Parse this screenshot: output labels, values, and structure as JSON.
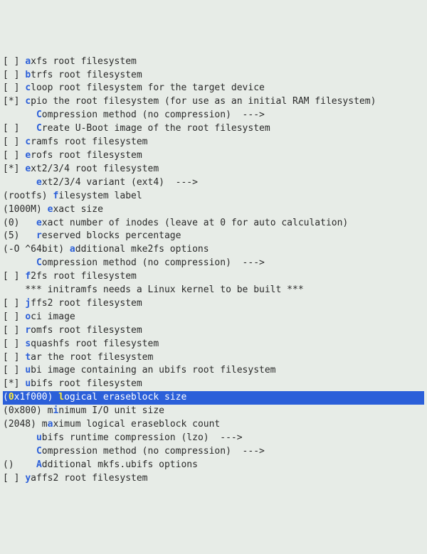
{
  "rows": [
    {
      "prefix": "[ ] ",
      "hot": "a",
      "rest": "xfs root filesystem",
      "interactable": true,
      "name": "opt-axfs"
    },
    {
      "prefix": "[ ] ",
      "hot": "b",
      "rest": "trfs root filesystem",
      "interactable": true,
      "name": "opt-btrfs"
    },
    {
      "prefix": "[ ] ",
      "hot": "c",
      "rest": "loop root filesystem for the target device",
      "interactable": true,
      "name": "opt-cloop"
    },
    {
      "prefix": "[*] ",
      "hot": "c",
      "rest": "pio the root filesystem (for use as an initial RAM filesystem)",
      "interactable": true,
      "name": "opt-cpio"
    },
    {
      "prefix": "      ",
      "hot": "C",
      "rest": "ompression method (no compression)  --->",
      "interactable": true,
      "name": "menu-cpio-compression"
    },
    {
      "prefix": "[ ]   ",
      "hot": "C",
      "rest": "reate U-Boot image of the root filesystem",
      "interactable": true,
      "name": "opt-cpio-uboot"
    },
    {
      "prefix": "[ ] ",
      "hot": "c",
      "rest": "ramfs root filesystem",
      "interactable": true,
      "name": "opt-cramfs"
    },
    {
      "prefix": "[ ] ",
      "hot": "e",
      "rest": "rofs root filesystem",
      "interactable": true,
      "name": "opt-erofs"
    },
    {
      "prefix": "[*] ",
      "hot": "e",
      "rest": "xt2/3/4 root filesystem",
      "interactable": true,
      "name": "opt-ext"
    },
    {
      "prefix": "      ",
      "hot": "e",
      "rest": "xt2/3/4 variant (ext4)  --->",
      "interactable": true,
      "name": "menu-ext-variant"
    },
    {
      "prefix": "(rootfs) ",
      "hot": "f",
      "rest": "ilesystem label",
      "interactable": true,
      "name": "input-fs-label"
    },
    {
      "prefix": "(1000M) ",
      "hot": "e",
      "rest": "xact size",
      "interactable": true,
      "name": "input-exact-size"
    },
    {
      "prefix": "(0)   ",
      "hot": "e",
      "rest": "xact number of inodes (leave at 0 for auto calculation)",
      "interactable": true,
      "name": "input-inodes"
    },
    {
      "prefix": "(5)   ",
      "hot": "r",
      "rest": "eserved blocks percentage",
      "interactable": true,
      "name": "input-reserved-blocks"
    },
    {
      "prefix": "(-O ^64bit) ",
      "hot": "a",
      "rest": "dditional mke2fs options",
      "interactable": true,
      "name": "input-mke2fs-options"
    },
    {
      "prefix": "      ",
      "hot": "C",
      "rest": "ompression method (no compression)  --->",
      "interactable": true,
      "name": "menu-ext-compression"
    },
    {
      "prefix": "[ ] ",
      "hot": "f",
      "rest": "2fs root filesystem",
      "interactable": true,
      "name": "opt-f2fs"
    },
    {
      "prefix": "    *** initramfs needs a Linux kernel to be built ***",
      "hot": "",
      "rest": "",
      "interactable": false,
      "name": "comment-initramfs"
    },
    {
      "prefix": "[ ] ",
      "hot": "j",
      "rest": "ffs2 root filesystem",
      "interactable": true,
      "name": "opt-jffs2"
    },
    {
      "prefix": "[ ] ",
      "hot": "o",
      "rest": "ci image",
      "interactable": true,
      "name": "opt-oci"
    },
    {
      "prefix": "[ ] ",
      "hot": "r",
      "rest": "omfs root filesystem",
      "interactable": true,
      "name": "opt-romfs"
    },
    {
      "prefix": "[ ] ",
      "hot": "s",
      "rest": "quashfs root filesystem",
      "interactable": true,
      "name": "opt-squashfs"
    },
    {
      "prefix": "[ ] ",
      "hot": "t",
      "rest": "ar the root filesystem",
      "interactable": true,
      "name": "opt-tar"
    },
    {
      "prefix": "[ ] ",
      "hot": "u",
      "rest": "bi image containing an ubifs root filesystem",
      "interactable": true,
      "name": "opt-ubi"
    },
    {
      "prefix": "[*] ",
      "hot": "u",
      "rest": "bifs root filesystem",
      "interactable": true,
      "name": "opt-ubifs"
    },
    {
      "prefix": "(",
      "hot": "0",
      "rest": "x1f000) ",
      "hot2": "l",
      "rest2": "ogical eraseblock size",
      "interactable": true,
      "name": "input-leb-size",
      "selected": true
    },
    {
      "prefix": "(0x800) m",
      "hot": "i",
      "rest": "nimum I/O unit size",
      "interactable": true,
      "name": "input-min-io"
    },
    {
      "prefix": "(2048) m",
      "hot": "a",
      "rest": "ximum logical eraseblock count",
      "interactable": true,
      "name": "input-max-leb"
    },
    {
      "prefix": "      ",
      "hot": "u",
      "rest": "bifs runtime compression (lzo)  --->",
      "interactable": true,
      "name": "menu-ubifs-runtime-compression"
    },
    {
      "prefix": "      ",
      "hot": "C",
      "rest": "ompression method (no compression)  --->",
      "interactable": true,
      "name": "menu-ubifs-compression"
    },
    {
      "prefix": "()    ",
      "hot": "A",
      "rest": "dditional mkfs.ubifs options",
      "interactable": true,
      "name": "input-mkfs-ubifs-options"
    },
    {
      "prefix": "[ ] ",
      "hot": "y",
      "rest": "affs2 root filesystem",
      "interactable": true,
      "name": "opt-yaffs2"
    }
  ]
}
